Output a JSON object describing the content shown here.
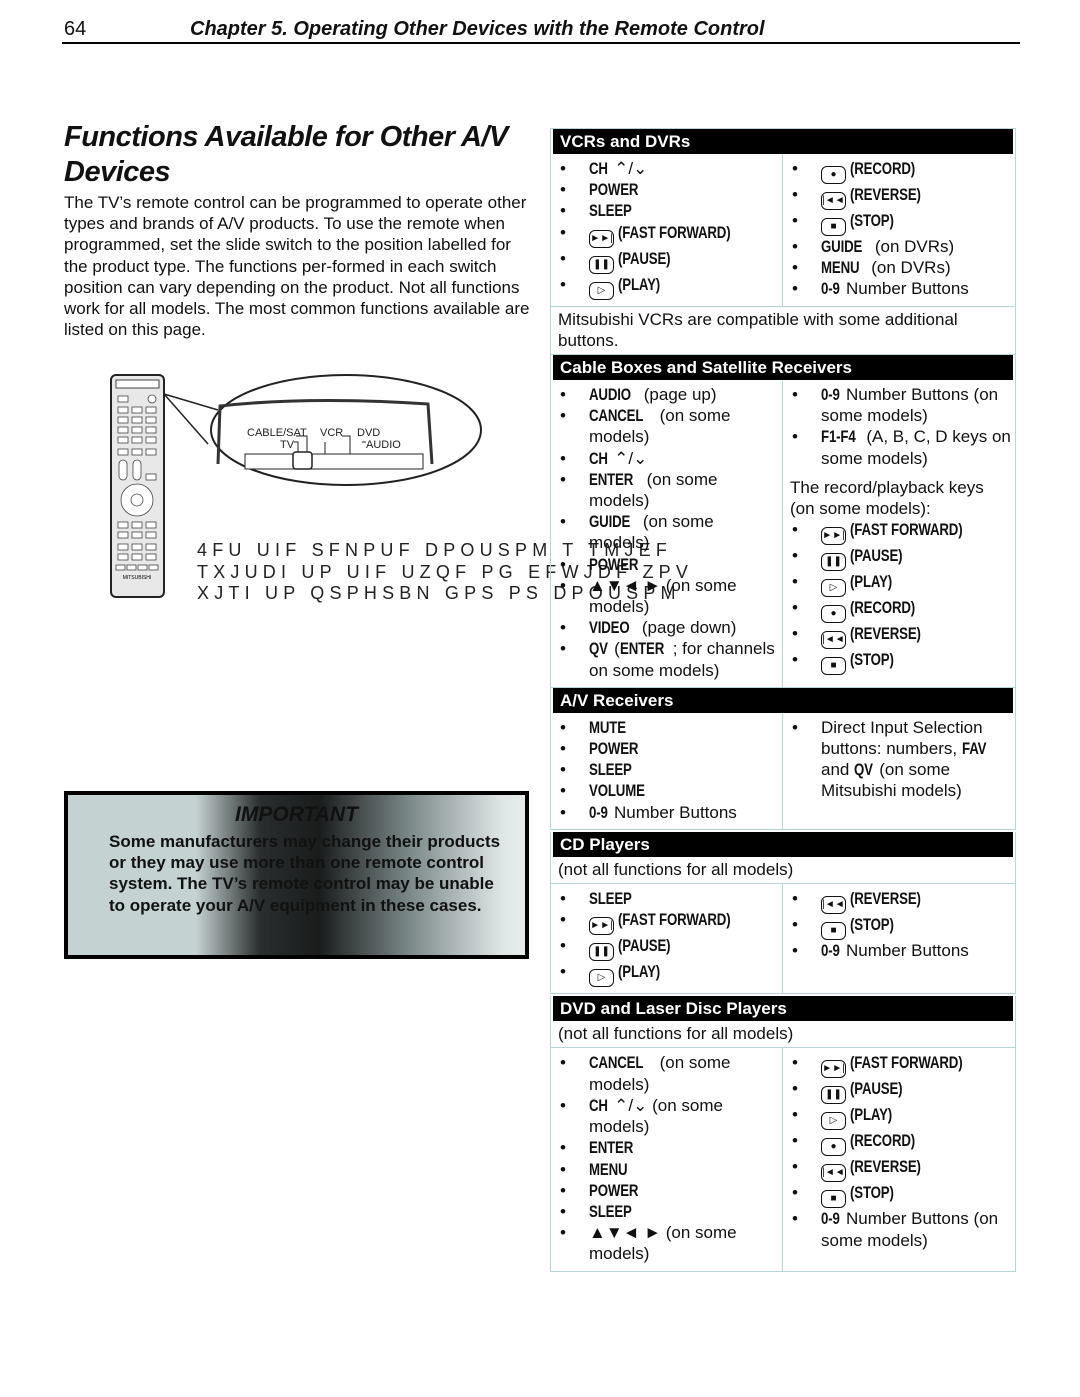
{
  "header": {
    "page_number": "64",
    "chapter": "Chapter 5.  Operating Other Devices with the Remote Control"
  },
  "title": "Functions Available for Other A/V Devices",
  "intro": "The TV’s remote control can be programmed to operate other types and brands of A/V products.  To use the remote when programmed, set the slide switch to the position labelled for the product type.  The functions per-formed in each switch position can vary depending on the product.  Not all functions work for all models.  The most common functions available are listed on this page.",
  "remote": {
    "switch_labels": [
      "CABLE/SAT",
      "VCR",
      "DVD",
      "TV",
      "AUDIO"
    ],
    "brand": "MITSUBISHI"
  },
  "garbled_text": [
    "4FU UIF SFNPUF DPOUSPM T TMJEF",
    "TXJUDI UP UIF UZQF PG EFWJDF ZPV",
    "XJTI UP QSPHSBN GPS PS DPOUSPM"
  ],
  "important": {
    "title": "IMPORTANT",
    "text": "Some manufacturers may change their products or they may use more than one remote control system.  The TV’s remote control may be unable to operate your A/V equipment in these cases."
  },
  "colors": {
    "header_bg": "#000000",
    "table_border": "#b7d6d8"
  },
  "sections": [
    {
      "title": "VCRs and DVRs",
      "left": [
        {
          "key": "CH",
          "arrows": "up-down"
        },
        {
          "key": "POWER"
        },
        {
          "key": "SLEEP"
        },
        {
          "icon": "fast-forward",
          "key": "(FAST FORWARD)"
        },
        {
          "icon": "pause",
          "key": "(PAUSE)"
        },
        {
          "icon": "play",
          "key": "(PLAY)"
        }
      ],
      "right": [
        {
          "icon": "record",
          "key": "(RECORD)"
        },
        {
          "icon": "reverse",
          "key": "(REVERSE)"
        },
        {
          "icon": "stop",
          "key": "(STOP)"
        },
        {
          "key": "GUIDE",
          "text": " (on DVRs)"
        },
        {
          "key": "MENU",
          "text": " (on DVRs)"
        },
        {
          "key": "0-9",
          "text": " Number Buttons"
        }
      ],
      "after": "Mitsubishi VCRs are compatible with some additional buttons."
    },
    {
      "title": "Cable Boxes and Satellite Receivers",
      "left": [
        {
          "key": "AUDIO",
          "text": " (page up)"
        },
        {
          "key": "CANCEL",
          "text": " (on some models)"
        },
        {
          "key": "CH",
          "arrows": "up-down"
        },
        {
          "key": "ENTER",
          "text": " (on some models)"
        },
        {
          "key": "GUIDE",
          "text": " (on some models)"
        },
        {
          "key": "POWER"
        },
        {
          "arrows": "four",
          "text": " (on some models)"
        },
        {
          "key": "VIDEO",
          "text": " (page down)"
        },
        {
          "key": "QV",
          "key2": "ENTER",
          "text": "; for channels on some models)"
        }
      ],
      "right": [
        {
          "key": "0-9",
          "text": " Number Buttons (on some models)"
        },
        {
          "key": "F1-F4",
          "text": " (A, B, C, D keys on some models)"
        },
        {
          "para": "The record/playback keys (on some models):"
        },
        {
          "icon": "fast-forward",
          "key": "(FAST FORWARD)"
        },
        {
          "icon": "pause",
          "key": "(PAUSE)"
        },
        {
          "icon": "play",
          "key": "(PLAY)"
        },
        {
          "icon": "record",
          "key": "(RECORD)"
        },
        {
          "icon": "reverse",
          "key": "(REVERSE)"
        },
        {
          "icon": "stop",
          "key": "(STOP)"
        }
      ]
    },
    {
      "title": "A/V Receivers",
      "left": [
        {
          "key": "MUTE"
        },
        {
          "key": "POWER"
        },
        {
          "key": "SLEEP"
        },
        {
          "key": "VOLUME"
        },
        {
          "key": "0-9",
          "text": " Number Buttons"
        }
      ],
      "right": [
        {
          "text": "Direct Input Selection buttons:  numbers, ",
          "key": "FAV",
          "text2": " and ",
          "key3": "QV",
          "text3": " (on some Mitsubishi models)"
        }
      ]
    },
    {
      "title": "CD Players",
      "before": "(not all functions for all models)",
      "left": [
        {
          "key": "SLEEP"
        },
        {
          "icon": "fast-forward",
          "key": "(FAST FORWARD)"
        },
        {
          "icon": "pause",
          "key": "(PAUSE)"
        },
        {
          "icon": "play",
          "key": "(PLAY)"
        }
      ],
      "right": [
        {
          "icon": "reverse",
          "key": "(REVERSE)"
        },
        {
          "icon": "stop",
          "key": "(STOP)"
        },
        {
          "key": "0-9",
          "text": " Number Buttons"
        }
      ]
    },
    {
      "title": "DVD and Laser Disc Players",
      "before": "(not all functions for all models)",
      "left": [
        {
          "key": "CANCEL",
          "text": " (on some models)"
        },
        {
          "key": "CH",
          "arrows": "up-down",
          "text": " (on some models)"
        },
        {
          "key": "ENTER"
        },
        {
          "key": "MENU"
        },
        {
          "key": "POWER"
        },
        {
          "key": "SLEEP"
        },
        {
          "arrows": "four",
          "text": " (on some models)"
        }
      ],
      "right": [
        {
          "icon": "fast-forward",
          "key": "(FAST FORWARD)"
        },
        {
          "icon": "pause",
          "key": "(PAUSE)"
        },
        {
          "icon": "play",
          "key": "(PLAY)"
        },
        {
          "icon": "record",
          "key": "(RECORD)"
        },
        {
          "icon": "reverse",
          "key": "(REVERSE)"
        },
        {
          "icon": "stop",
          "key": "(STOP)"
        },
        {
          "key": "0-9",
          "text": " Number Buttons (on some models)"
        }
      ]
    }
  ]
}
